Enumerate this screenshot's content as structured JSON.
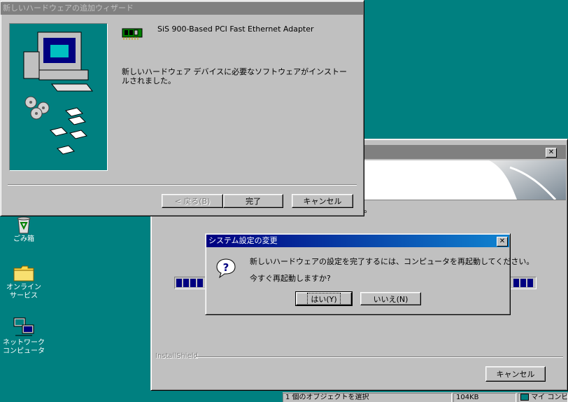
{
  "desktop": {
    "icons": [
      {
        "name": "recycle-bin",
        "label": "ごみ箱"
      },
      {
        "name": "online-services",
        "label": "オンライン\nサービス"
      },
      {
        "name": "network",
        "label": "ネットワーク\nコンピュータ"
      }
    ]
  },
  "wizard": {
    "title": "新しいハードウェアの追加ウィザード",
    "device": "SiS 900-Based PCI Fast Ethernet Adapter",
    "message": "新しいハードウェア デバイスに必要なソフトウェアがインストールされました。",
    "back_label": "< 戻る(B)",
    "finish_label": "完了",
    "cancel_label": "キャンセル"
  },
  "installer": {
    "title_hidden": "",
    "dot_text": "。",
    "brand": "InstallShield",
    "cancel_label": "キャンセル"
  },
  "dialog": {
    "title": "システム設定の変更",
    "line1": "新しいハードウェアの設定を完了するには、コンピュータを再起動してください。",
    "line2": "今すぐ再起動しますか?",
    "yes_label": "はい(Y)",
    "no_label": "いいえ(N)"
  },
  "statusbar": {
    "selection": "1 個のオブジェクトを選択",
    "size": "104KB",
    "location": "マイ コンピュータ"
  },
  "colors": {
    "desktop": "#008080",
    "title_active": "#000080",
    "progress": "#000080"
  }
}
